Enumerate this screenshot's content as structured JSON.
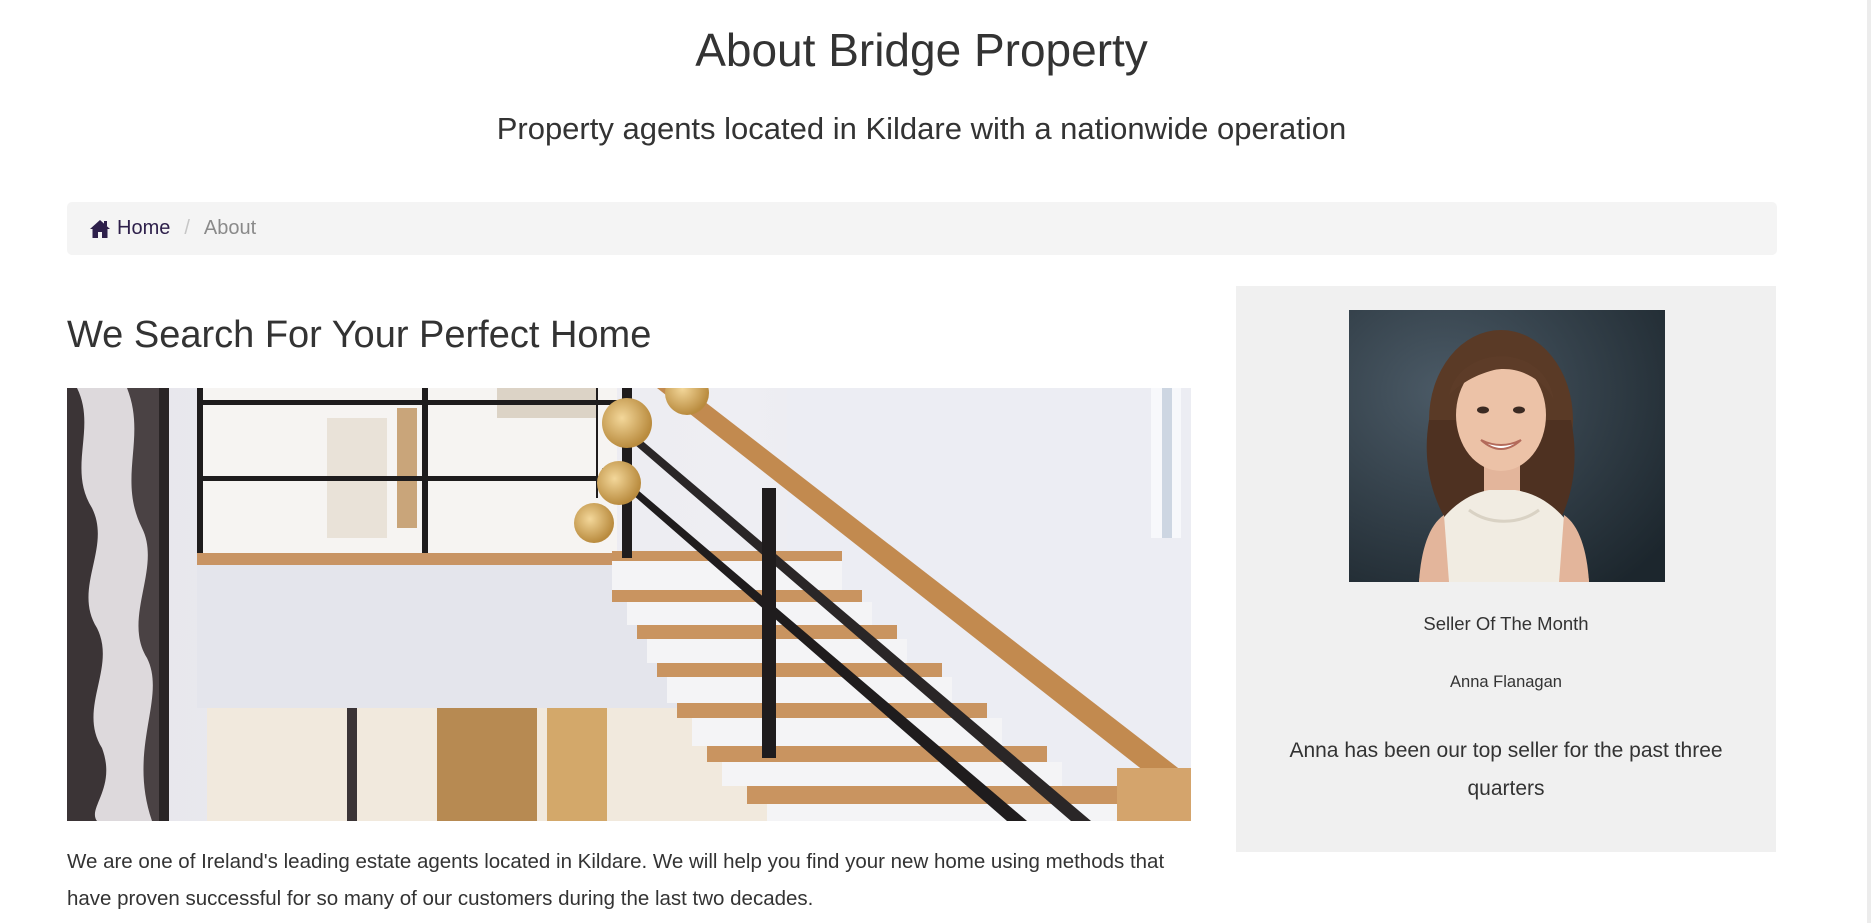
{
  "header": {
    "title": "About Bridge Property",
    "subtitle": "Property agents located in Kildare with a nationwide operation"
  },
  "breadcrumb": {
    "home_icon": "home-icon",
    "home_label": "Home",
    "separator": "/",
    "current_label": "About"
  },
  "main": {
    "heading": "We Search For Your Perfect Home",
    "intro": "We are one of Ireland's leading estate agents located in Kildare. We will help you find your new home using methods that have proven successful for so many of our customers during the last two decades."
  },
  "sidebar": {
    "award": "Seller Of The Month",
    "name": "Anna Flanagan",
    "description": "Anna has been our top seller for the past three quarters"
  },
  "colors": {
    "link": "#2d1f4a",
    "breadcrumb_bg": "#f4f4f4",
    "sidebar_bg": "#f0f0f0",
    "text": "#333333"
  }
}
